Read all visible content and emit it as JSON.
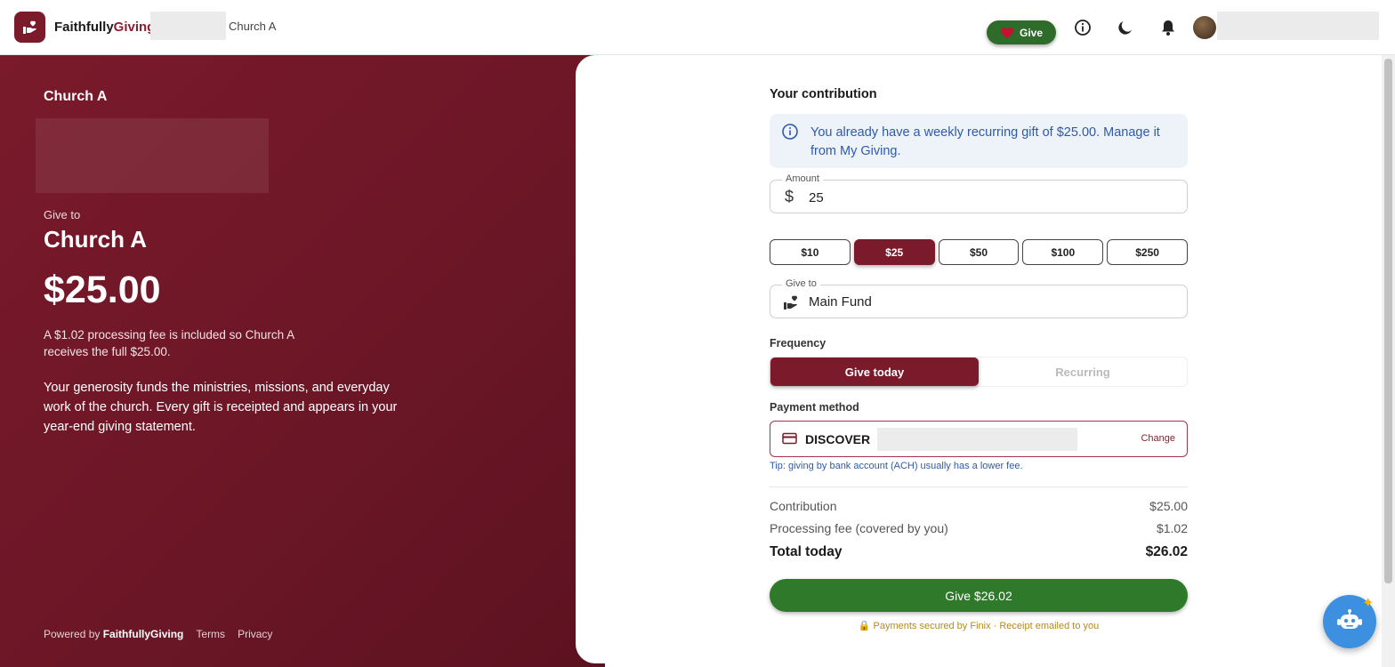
{
  "header": {
    "brand_part1": "Faithfully",
    "brand_part2": "Giving",
    "church_name": "Church A",
    "give_label": "Give",
    "icons": [
      "info-icon",
      "moon-icon",
      "bell-icon"
    ]
  },
  "left_panel": {
    "church_label": "Church A",
    "give_to_label": "Give to",
    "church_name": "Church A",
    "amount": "$25.00",
    "fee_note": "A $1.02 processing fee is included so Church A receives the full $25.00.",
    "description": "Your generosity funds the ministries, missions, and everyday work of the church. Every gift is receipted and appears in your year-end giving statement.",
    "footer": {
      "powered_prefix": "Powered by",
      "powered_brand": "FaithfullyGiving",
      "terms": "Terms",
      "privacy": "Privacy"
    }
  },
  "form": {
    "title": "Your contribution",
    "info_message": "You already have a weekly recurring gift of $25.00. Manage it from My Giving.",
    "amount_label": "Amount",
    "amount_currency": "$",
    "amount_value": "25",
    "presets": [
      {
        "label": "$10",
        "active": false
      },
      {
        "label": "$25",
        "active": true
      },
      {
        "label": "$50",
        "active": false
      },
      {
        "label": "$100",
        "active": false
      },
      {
        "label": "$250",
        "active": false
      }
    ],
    "give_to_label": "Give to",
    "fund": "Main Fund",
    "frequency_label": "Frequency",
    "frequency_options": [
      {
        "label": "Give today",
        "active": true
      },
      {
        "label": "Recurring",
        "active": false
      }
    ],
    "payment_label": "Payment method",
    "card_brand": "DISCOVER",
    "change_label": "Change",
    "tip": "Tip: giving by bank account (ACH) usually has a lower fee.",
    "summary": {
      "contribution_label": "Contribution",
      "contribution_value": "$25.00",
      "fee_label": "Processing fee (covered by you)",
      "fee_value": "$1.02",
      "total_label": "Total today",
      "total_value": "$26.02"
    },
    "submit_label": "Give $26.02",
    "secure_note": "Payments secured by Finix · Receipt emailed to you"
  },
  "colors": {
    "brand_maroon": "#7a1a2b",
    "give_green": "#2f7a2a",
    "info_blue": "#2f5aa8",
    "chat_blue": "#3d8fe0"
  }
}
